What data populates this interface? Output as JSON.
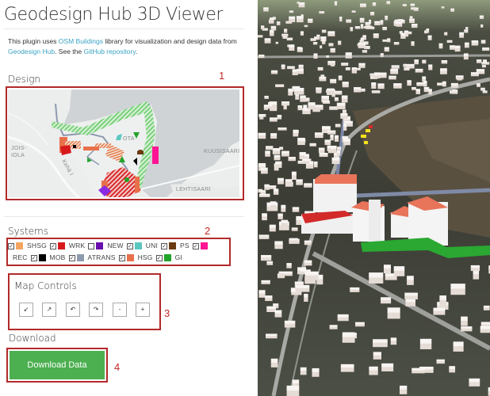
{
  "sidebar": {
    "title": "Geodesign Hub 3D Viewer",
    "intro": {
      "text_1": "This plugin uses ",
      "link_osm": "OSM Buildings",
      "text_2": " library for visualization and design data from ",
      "link_gdh": "Geodesign Hub",
      "text_3": ". See the ",
      "link_github": "GitHub repository",
      "text_4": "."
    },
    "design": {
      "label": "Design",
      "annotation": "1",
      "map_labels": [
        "JOIS-",
        "IOLA",
        "KUUSISAARI",
        "LEHTISAARI",
        "OTA",
        "Kehä I"
      ]
    },
    "systems": {
      "label": "Systems",
      "annotation": "2",
      "items": [
        {
          "code": "SHSG",
          "checked": true,
          "color": "#f4a460"
        },
        {
          "code": "WRK",
          "checked": true,
          "color": "#d7191c"
        },
        {
          "code": "NEW",
          "checked": false,
          "color": "#6a0dad"
        },
        {
          "code": "UNI",
          "checked": true,
          "color": "#5bc8c0"
        },
        {
          "code": "PS",
          "checked": true,
          "color": "#6b3a10"
        },
        {
          "code": "REC",
          "checked": true,
          "color": "#ff1493"
        },
        {
          "code": "MOB",
          "checked": true,
          "color": "#000000"
        },
        {
          "code": "ATRANS",
          "checked": true,
          "color": "#8e9aae"
        },
        {
          "code": "HSG",
          "checked": true,
          "color": "#e8704a"
        },
        {
          "code": "GI",
          "checked": true,
          "color": "#22a32a"
        }
      ]
    },
    "map_controls": {
      "label": "Map Controls",
      "annotation": "3",
      "buttons": [
        {
          "name": "tilt-down",
          "glyph": "↙"
        },
        {
          "name": "tilt-up",
          "glyph": "↗"
        },
        {
          "name": "rotate-left",
          "glyph": "↶"
        },
        {
          "name": "rotate-right",
          "glyph": "↷"
        },
        {
          "name": "zoom-out",
          "glyph": "-"
        },
        {
          "name": "zoom-in",
          "glyph": "+"
        }
      ]
    },
    "download": {
      "label": "Download",
      "button_label": "Download Data",
      "annotation": "4"
    }
  },
  "colors": {
    "accent_link": "#3aa3c4",
    "annotation_red": "#b22a2a",
    "download_green": "#4caf50"
  }
}
